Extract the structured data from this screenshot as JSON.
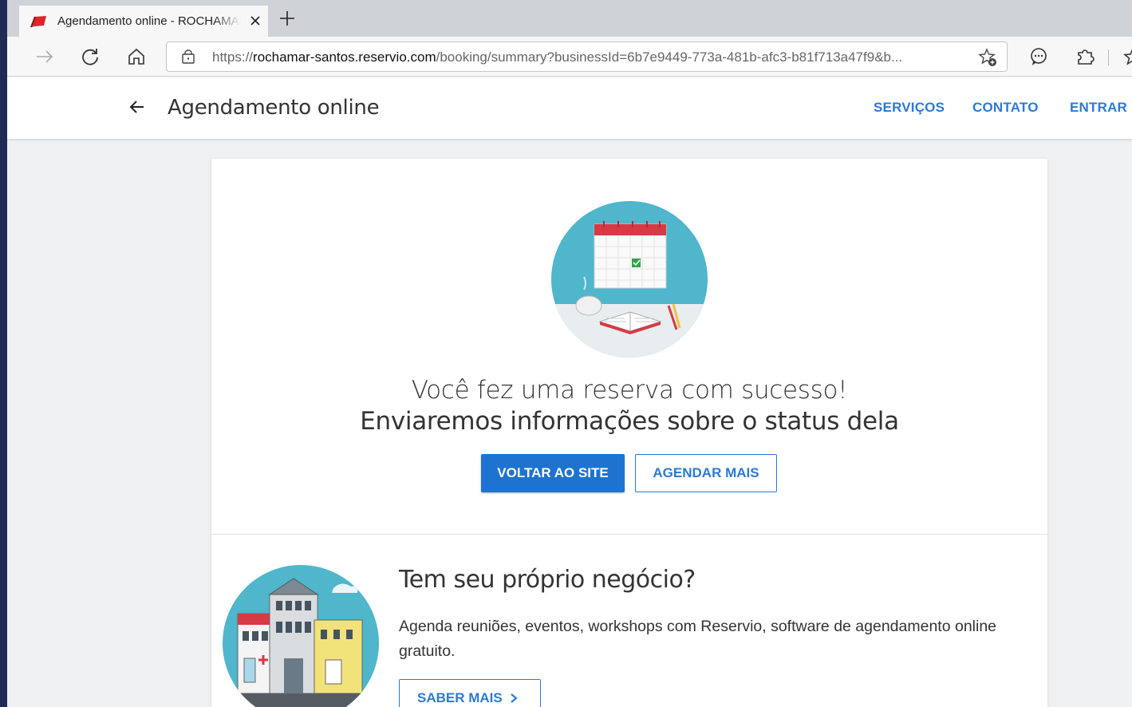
{
  "browser": {
    "tab_title": "Agendamento online - ROCHAMAR",
    "url_prefix": "https://",
    "url_domain": "rochamar-santos.reservio.com",
    "url_rest": "/booking/summary?businessId=6b7e9449-773a-481b-afc3-b81f713a47f9&b..."
  },
  "header": {
    "title": "Agendamento online",
    "nav": [
      {
        "label": "SERVIÇOS"
      },
      {
        "label": "CONTATO"
      },
      {
        "label": "ENTRAR"
      }
    ]
  },
  "confirmation": {
    "line1": "Você fez uma reserva com sucesso!",
    "line2": "Enviaremos informações sobre o status dela",
    "back_button": "VOLTAR AO SITE",
    "more_button": "AGENDAR MAIS"
  },
  "promo": {
    "title": "Tem seu próprio negócio?",
    "text": "Agenda reuniões, eventos, workshops com Reservio, software de agendamento online gratuito.",
    "button": "SABER MAIS"
  },
  "colors": {
    "accent": "#2b7ad3",
    "primary_button": "#1d73cf",
    "page_bg": "#eff0f2",
    "outer_bg": "#1f2b57"
  },
  "icons": {
    "favicon": "reservio-flag-icon",
    "back": "arrow-left-icon",
    "refresh": "refresh-icon",
    "home": "home-icon"
  }
}
